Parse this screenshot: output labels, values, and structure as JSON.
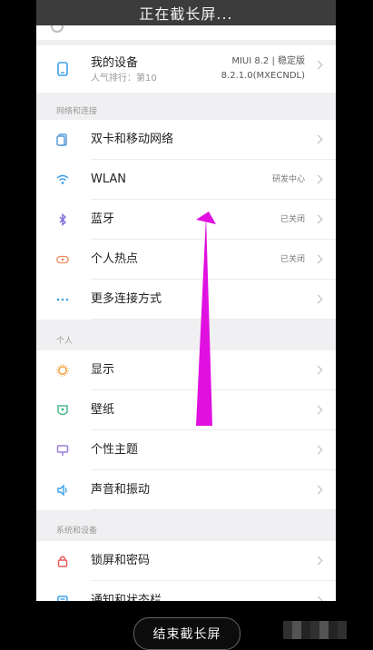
{
  "screenshot_banner": "正在截长屏...",
  "device": {
    "title": "我的设备",
    "subtitle": "人气排行：第10",
    "version_line1": "MIUI 8.2 | 稳定版",
    "version_line2": "8.2.1.0(MXECNDL)"
  },
  "sections": {
    "network": "网络和连接",
    "personal": "个人",
    "system": "系统和设备"
  },
  "rows": [
    {
      "label": "双卡和移动网络",
      "status": "",
      "icon": "sim-card-icon",
      "color": "#5a9bd5"
    },
    {
      "label": "WLAN",
      "status": "研发中心",
      "icon": "wifi-icon",
      "color": "#3ba0e8"
    },
    {
      "label": "蓝牙",
      "status": "已关闭",
      "icon": "bluetooth-icon",
      "color": "#7b6fd9"
    },
    {
      "label": "个人热点",
      "status": "已关闭",
      "icon": "hotspot-icon",
      "color": "#f08a5d"
    },
    {
      "label": "更多连接方式",
      "status": "",
      "icon": "more-dots-icon",
      "color": "#3ba0e8"
    },
    {
      "label": "显示",
      "status": "",
      "icon": "brightness-icon",
      "color": "#f2a341"
    },
    {
      "label": "壁纸",
      "status": "",
      "icon": "wallpaper-icon",
      "color": "#4cb88d"
    },
    {
      "label": "个性主题",
      "status": "",
      "icon": "theme-icon",
      "color": "#9b7fd9"
    },
    {
      "label": "声音和振动",
      "status": "",
      "icon": "sound-icon",
      "color": "#3ba0e8"
    },
    {
      "label": "锁屏和密码",
      "status": "",
      "icon": "lock-icon",
      "color": "#e85a5a"
    },
    {
      "label": "通知和状态栏",
      "status": "",
      "icon": "notification-icon",
      "color": "#3ba0e8"
    }
  ],
  "end_button": "结束截长屏",
  "colors": {
    "arrow": "#e010e0",
    "accent": "#3ba0e8"
  }
}
